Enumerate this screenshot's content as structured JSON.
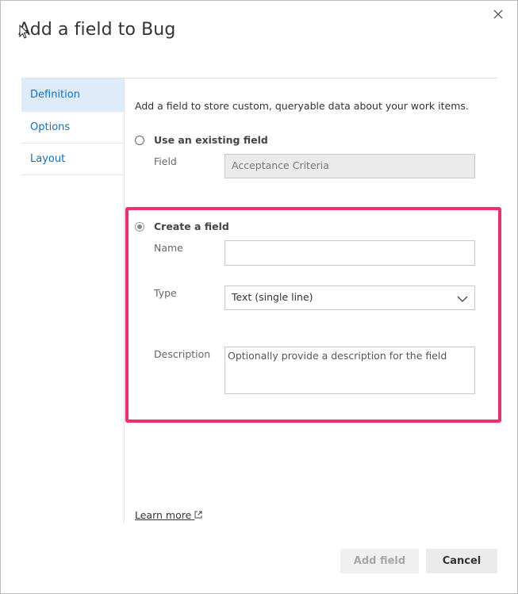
{
  "dialog": {
    "title": "Add a field to Bug"
  },
  "nav": {
    "items": [
      {
        "label": "Definition",
        "active": true
      },
      {
        "label": "Options",
        "active": false
      },
      {
        "label": "Layout",
        "active": false
      }
    ]
  },
  "form": {
    "intro": "Add a field to store custom, queryable data about your work items.",
    "existing": {
      "radio_label": "Use an existing field",
      "field_label": "Field",
      "field_value": "Acceptance Criteria"
    },
    "create": {
      "radio_label": "Create a field",
      "name_label": "Name",
      "name_value": "",
      "type_label": "Type",
      "type_value": "Text (single line)",
      "description_label": "Description",
      "description_placeholder": "Optionally provide a description for the field"
    },
    "learn_more": "Learn more"
  },
  "buttons": {
    "add_field": "Add field",
    "cancel": "Cancel"
  },
  "colors": {
    "highlight": "#ee2f6d",
    "nav_active_bg": "#deecf9",
    "link_blue": "#106ebe"
  }
}
